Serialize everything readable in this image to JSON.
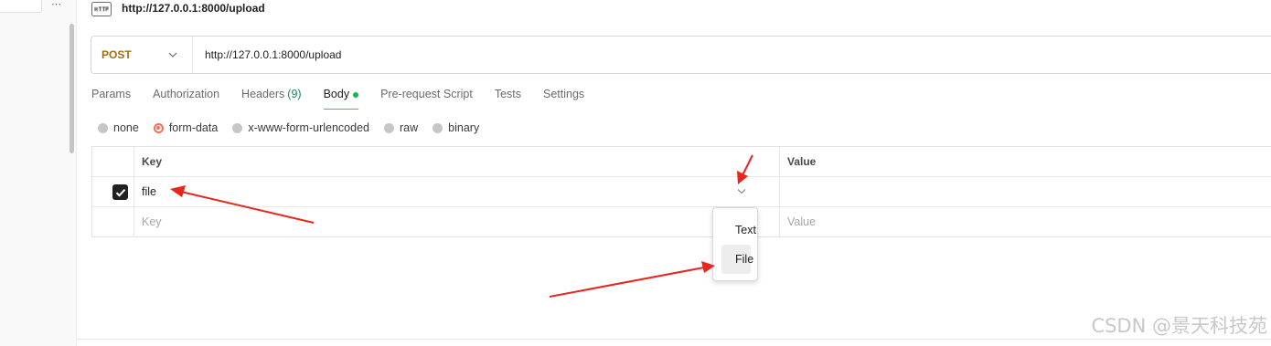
{
  "sidebar": {
    "more_icon": "⋯"
  },
  "request": {
    "title": "http://127.0.0.1:8000/upload",
    "method": "POST",
    "url": "http://127.0.0.1:8000/upload"
  },
  "tabs": [
    {
      "label": "Params"
    },
    {
      "label": "Authorization"
    },
    {
      "label": "Headers",
      "count": "(9)"
    },
    {
      "label": "Body",
      "active": true
    },
    {
      "label": "Pre-request Script"
    },
    {
      "label": "Tests"
    },
    {
      "label": "Settings"
    }
  ],
  "body_types": [
    {
      "label": "none"
    },
    {
      "label": "form-data",
      "selected": true
    },
    {
      "label": "x-www-form-urlencoded"
    },
    {
      "label": "raw"
    },
    {
      "label": "binary"
    }
  ],
  "form_table": {
    "headers": {
      "key": "Key",
      "value": "Value"
    },
    "row": {
      "key": "file",
      "checked": true
    },
    "placeholders": {
      "key": "Key",
      "value": "Value"
    }
  },
  "type_menu": {
    "items": [
      "Text",
      "File"
    ]
  },
  "watermark": "CSDN @景天科技苑",
  "colors": {
    "method": "#a06d16",
    "accent": "#ff6c37",
    "active_dot": "#0cbb52",
    "annotation": "#e8261e"
  }
}
